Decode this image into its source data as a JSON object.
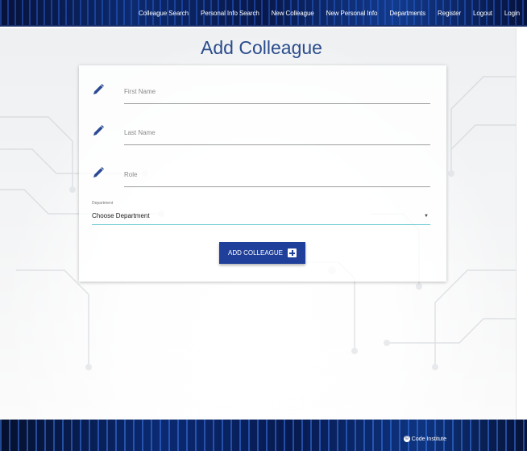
{
  "nav": {
    "links": [
      {
        "label": "Colleague Search"
      },
      {
        "label": "Personal Info Search"
      },
      {
        "label": "New Colleague"
      },
      {
        "label": "New Personal Info"
      },
      {
        "label": "Departments"
      },
      {
        "label": "Register"
      },
      {
        "label": "Logout"
      },
      {
        "label": "Login"
      }
    ]
  },
  "page": {
    "title": "Add Colleague"
  },
  "form": {
    "first_name": {
      "placeholder": "First Name",
      "value": "",
      "icon": "pencil-icon"
    },
    "last_name": {
      "placeholder": "Last Name",
      "value": "",
      "icon": "pencil-icon"
    },
    "role": {
      "placeholder": "Role",
      "value": "",
      "icon": "pencil-icon"
    },
    "department": {
      "label": "Department",
      "selected": "Choose Department"
    },
    "submit_label": "ADD COLLEAGUE"
  },
  "footer": {
    "credit": "Code Institute",
    "credit_icon": "copyright-icon"
  },
  "colors": {
    "accent": "#1f3f9a",
    "title": "#2b4c8c",
    "select_underline": "#64c8d0"
  }
}
